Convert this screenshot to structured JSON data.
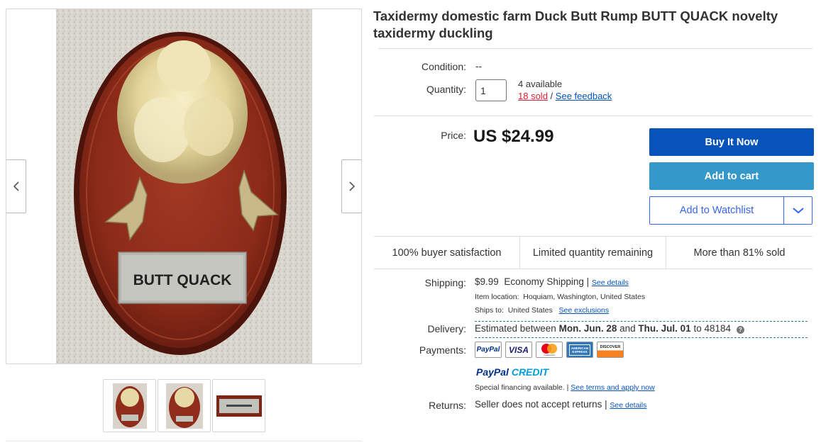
{
  "item": {
    "title": "Taxidermy domestic farm Duck Butt Rump BUTT QUACK novelty taxidermy duckling",
    "plaque_text": "BUTT QUACK"
  },
  "condition": {
    "label": "Condition:",
    "value": "--"
  },
  "quantity": {
    "label": "Quantity:",
    "value": "1",
    "available": "4 available",
    "sold": "18 sold",
    "separator": "/",
    "feedback_link": "See feedback"
  },
  "price": {
    "label": "Price:",
    "value": "US $24.99"
  },
  "actions": {
    "buy_now": "Buy It Now",
    "add_to_cart": "Add to cart",
    "watchlist": "Add to Watchlist"
  },
  "signals": {
    "satisfaction": "100% buyer satisfaction",
    "limited": "Limited quantity remaining",
    "sold_pct": "More than 81% sold"
  },
  "shipping": {
    "label": "Shipping:",
    "cost": "$9.99",
    "method": "Economy Shipping",
    "details_link": "See details",
    "location_label": "Item location:",
    "location": "Hoquiam, Washington, United States",
    "ships_to_label": "Ships to:",
    "ships_to": "United States",
    "exclusions_link": "See exclusions"
  },
  "delivery": {
    "label": "Delivery:",
    "prefix": "Estimated between",
    "date_start": "Mon. Jun. 28",
    "and": "and",
    "date_end": "Thu. Jul. 01",
    "to": "to 48184",
    "help": "?"
  },
  "payments": {
    "label": "Payments:",
    "cards": [
      "PayPal",
      "VISA",
      "mastercard",
      "AMERICAN EXPRESS",
      "DISCOVER"
    ],
    "paypal_credit_a": "PayPal",
    "paypal_credit_b": "CREDIT",
    "financing": "Special financing available.",
    "terms_link": "See terms and apply now"
  },
  "returns": {
    "label": "Returns:",
    "value": "Seller does not accept returns",
    "details_link": "See details"
  },
  "colors": {
    "primary_blue": "#0654ba",
    "cart_blue": "#3498ca",
    "watch_blue": "#3665f3",
    "red": "#dd1e31"
  },
  "icons": [
    "chevron-left-icon",
    "chevron-right-icon",
    "chevron-down-icon",
    "help-icon"
  ]
}
